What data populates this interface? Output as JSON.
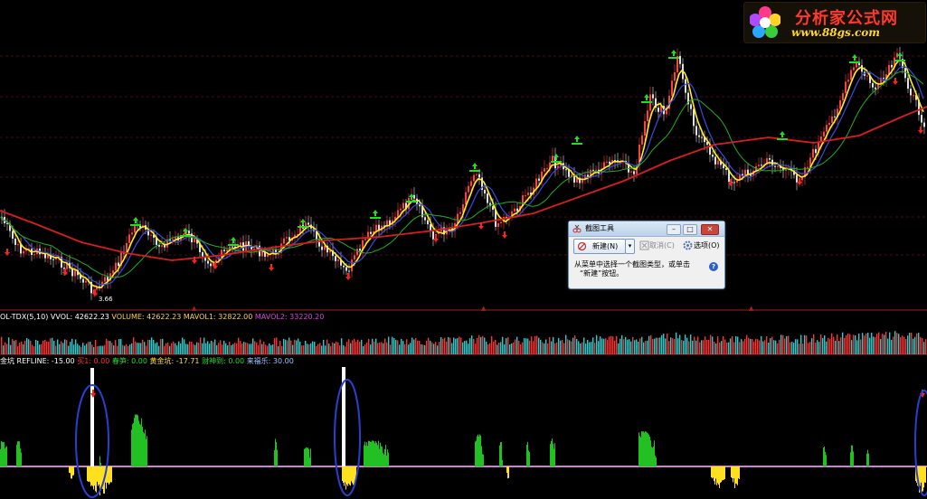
{
  "logo": {
    "title": "分析家公式网",
    "url": "www.88gs.com"
  },
  "snipping_tool": {
    "title": "截图工具",
    "minimize": "–",
    "maximize": "□",
    "close": "✕",
    "new_label": "新建(N)",
    "dropdown": "▾",
    "cancel_label": "取消(C)",
    "options_label": "选项(O)",
    "message_line1": "从菜单中选择一个截图类型，或单击",
    "message_line2": "“新建”按钮。",
    "help": "?"
  },
  "price_panel": {
    "low_label": "3.66"
  },
  "volume_panel": {
    "name": "OL-TDX(5,10)",
    "items": [
      {
        "text": "VVOL: 42622.23",
        "color": "#ffffff"
      },
      {
        "text": "VOLUME: 42622.23",
        "color": "#ffd23c"
      },
      {
        "text": "MAVOL1: 32822.00",
        "color": "#ffd23c"
      },
      {
        "text": "MAVOL2: 33220.20",
        "color": "#e040e0"
      }
    ]
  },
  "indicator_panel": {
    "name": "金坑",
    "items": [
      {
        "text": "REFLINE: -15.00",
        "color": "#ffffff"
      },
      {
        "text": "买1: 0.00",
        "color": "#ff3030"
      },
      {
        "text": "春笋: 0.00",
        "color": "#22dd22"
      },
      {
        "text": "黄金坑: -17.71",
        "color": "#ffe020"
      },
      {
        "text": "财神到: 0.00",
        "color": "#22dd22"
      },
      {
        "text": "来福乐: 30.00",
        "color": "#9cc0ff"
      }
    ]
  },
  "colors": {
    "background": "#000000",
    "grid": "#4a0b0b",
    "separator": "#b01818",
    "ma_long": "#d81e1e",
    "ma_mid": "#20b020",
    "ma_short": "#3a4ae0",
    "ma_fast": "#ffee22",
    "candle_up": "#ff4040",
    "candle_down": "#e0e0e0",
    "buy_arrow": "#ff2020",
    "sell_marker": "#22dd22",
    "volume_up": "#ff3030",
    "volume_down": "#20d0d0",
    "ind_green": "#22c022",
    "ind_yellow": "#ffe020",
    "ind_white": "#ffffff",
    "ind_refline": "#d080d0",
    "annotation": "#2a3fd0"
  },
  "icons": [
    "flower-logo-icon",
    "scissors-icon",
    "new-snip-icon",
    "cancel-icon",
    "options-gear-icon",
    "help-icon"
  ]
}
